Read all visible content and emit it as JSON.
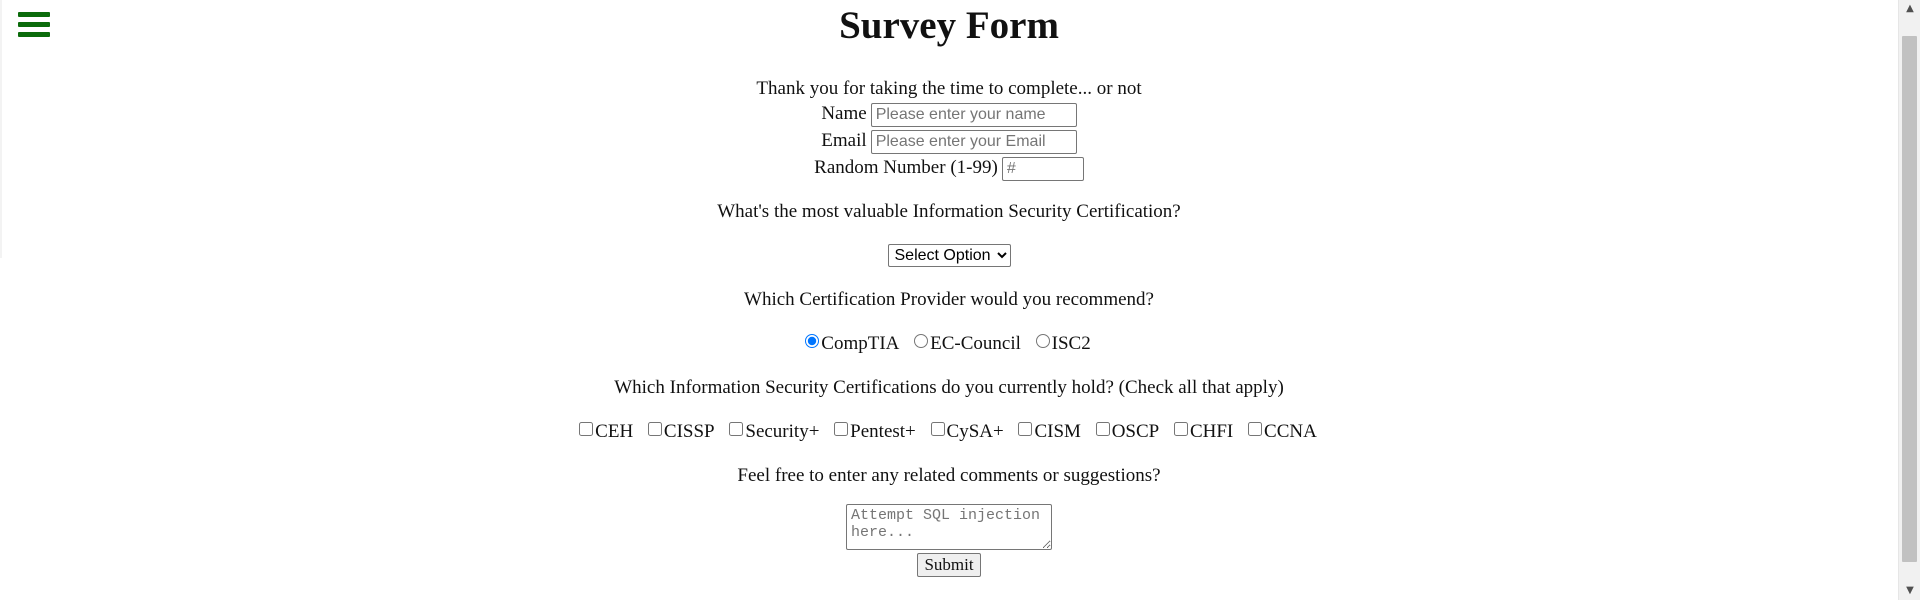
{
  "menu": {
    "icon": "hamburger-menu-icon"
  },
  "form": {
    "title": "Survey Form",
    "subtitle": "Thank you for taking the time to complete... or not",
    "name": {
      "label": "Name",
      "placeholder": "Please enter your name",
      "value": ""
    },
    "email": {
      "label": "Email",
      "placeholder": "Please enter your Email",
      "value": ""
    },
    "number": {
      "label": "Random Number (1-99)",
      "placeholder": "#",
      "value": ""
    },
    "q_cert": "What's the most valuable Information Security Certification?",
    "select": {
      "selected": "Select Option"
    },
    "q_provider": "Which Certification Provider would you recommend?",
    "providers": [
      {
        "label": "CompTIA",
        "checked": true
      },
      {
        "label": "EC-Council",
        "checked": false
      },
      {
        "label": "ISC2",
        "checked": false
      }
    ],
    "q_hold": "Which Information Security Certifications do you currently hold? (Check all that apply)",
    "certs": [
      {
        "label": "CEH",
        "checked": false
      },
      {
        "label": "CISSP",
        "checked": false
      },
      {
        "label": "Security+",
        "checked": false
      },
      {
        "label": "Pentest+",
        "checked": false
      },
      {
        "label": "CySA+",
        "checked": false
      },
      {
        "label": "CISM",
        "checked": false
      },
      {
        "label": "OSCP",
        "checked": false
      },
      {
        "label": "CHFI",
        "checked": false
      },
      {
        "label": "CCNA",
        "checked": false
      }
    ],
    "q_comments": "Feel free to enter any related comments or suggestions?",
    "comments": {
      "placeholder": "Attempt SQL injection here...",
      "value": ""
    },
    "submit_label": "Submit"
  },
  "colors": {
    "menu_icon": "#0b6b0b",
    "scroll_thumb": "#c1c1c1",
    "scroll_track": "#f1f1f1"
  },
  "scrollbar": {
    "up_icon": "scroll-up-arrow-icon",
    "down_icon": "scroll-down-arrow-icon"
  }
}
